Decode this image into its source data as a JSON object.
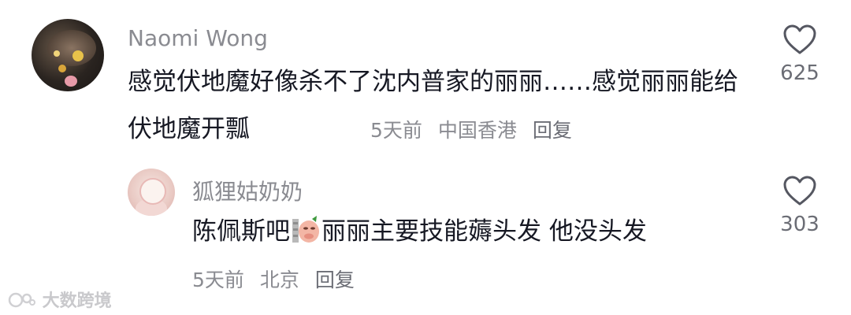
{
  "comments": [
    {
      "username": "Naomi Wong",
      "text": "感觉伏地魔好像杀不了沈内普家的丽丽……感觉丽丽能给伏地魔开瓢",
      "time": "5天前",
      "location": "中国香港",
      "reply_label": "回复",
      "likes": "625"
    },
    {
      "username": "狐狸姑奶奶",
      "text_before": "陈佩斯吧",
      "sticker": "pig-emoji-sticker",
      "text_after": "丽丽主要技能薅头发 他没头发",
      "time": "5天前",
      "location": "北京",
      "reply_label": "回复",
      "likes": "303"
    }
  ],
  "watermark": "大数跨境",
  "icons": {
    "like": "heart-outline-icon"
  },
  "colors": {
    "text": "#161823",
    "muted": "#8a8b91"
  }
}
